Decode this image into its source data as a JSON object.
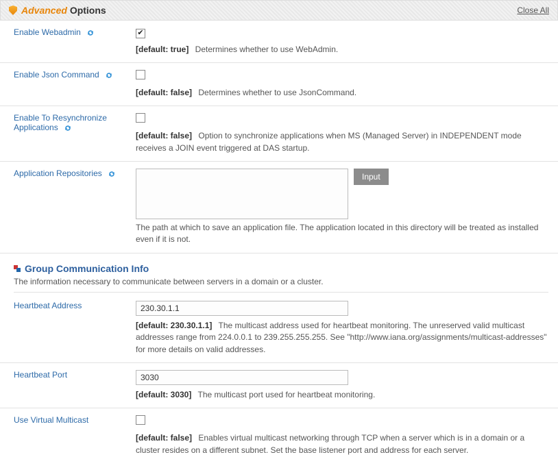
{
  "header": {
    "advanced": "Advanced",
    "options": "Options",
    "close_all": "Close All"
  },
  "rows": {
    "enable_webadmin": {
      "label": "Enable Webadmin",
      "checked": true,
      "default": "[default: true]",
      "desc": "Determines whether to use WebAdmin."
    },
    "enable_json": {
      "label": "Enable Json Command",
      "checked": false,
      "default": "[default: false]",
      "desc": "Determines whether to use JsonCommand."
    },
    "enable_resync": {
      "label": "Enable To Resynchronize Applications",
      "checked": false,
      "default": "[default: false]",
      "desc": "Option to synchronize applications when MS (Managed Server) in INDEPENDENT mode receives a JOIN event triggered at DAS startup."
    },
    "app_repos": {
      "label": "Application Repositories",
      "input_btn": "Input",
      "desc": "The path at which to save an application file. The application located in this directory will be treated as installed even if it is not."
    },
    "hb_addr": {
      "label": "Heartbeat Address",
      "value": "230.30.1.1",
      "default": "[default: 230.30.1.1]",
      "desc": "The multicast address used for heartbeat monitoring. The unreserved valid multicast addresses range from 224.0.0.1 to 239.255.255.255. See \"http://www.iana.org/assignments/multicast-addresses\" for more details on valid addresses."
    },
    "hb_port": {
      "label": "Heartbeat Port",
      "value": "3030",
      "default": "[default: 3030]",
      "desc": "The multicast port used for heartbeat monitoring."
    },
    "use_vm": {
      "label": "Use Virtual Multicast",
      "checked": false,
      "default": "[default: false]",
      "desc": "Enables virtual multicast networking through TCP when a server which is in a domain or a cluster resides on a different subnet. Set the base listener port and address for each server."
    }
  },
  "section": {
    "title": "Group Communication Info",
    "sub": "The information necessary to communicate between servers in a domain or a cluster."
  }
}
